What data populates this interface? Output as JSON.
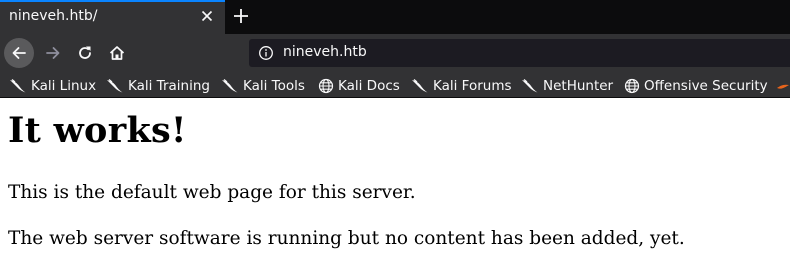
{
  "tab": {
    "title": "nineveh.htb/"
  },
  "urlbar": {
    "url": "nineveh.htb"
  },
  "bookmarks": [
    {
      "label": "Kali Linux",
      "icon": "kali-dragon-icon"
    },
    {
      "label": "Kali Training",
      "icon": "kali-dragon-icon"
    },
    {
      "label": "Kali Tools",
      "icon": "kali-dragon-icon"
    },
    {
      "label": "Kali Docs",
      "icon": "globe-icon"
    },
    {
      "label": "Kali Forums",
      "icon": "kali-dragon-icon"
    },
    {
      "label": "NetHunter",
      "icon": "kali-dragon-icon"
    },
    {
      "label": "Offensive Security",
      "icon": "globe-icon"
    }
  ],
  "page": {
    "heading": "It works!",
    "para1": "This is the default web page for this server.",
    "para2": "The web server software is running but no content has been added, yet."
  },
  "colors": {
    "tab_accent": "#0a84ff",
    "toolbar": "#323234",
    "tabstrip": "#0c0c0d",
    "urlbar": "#1c1b22",
    "text_light": "#f9f9fa"
  }
}
